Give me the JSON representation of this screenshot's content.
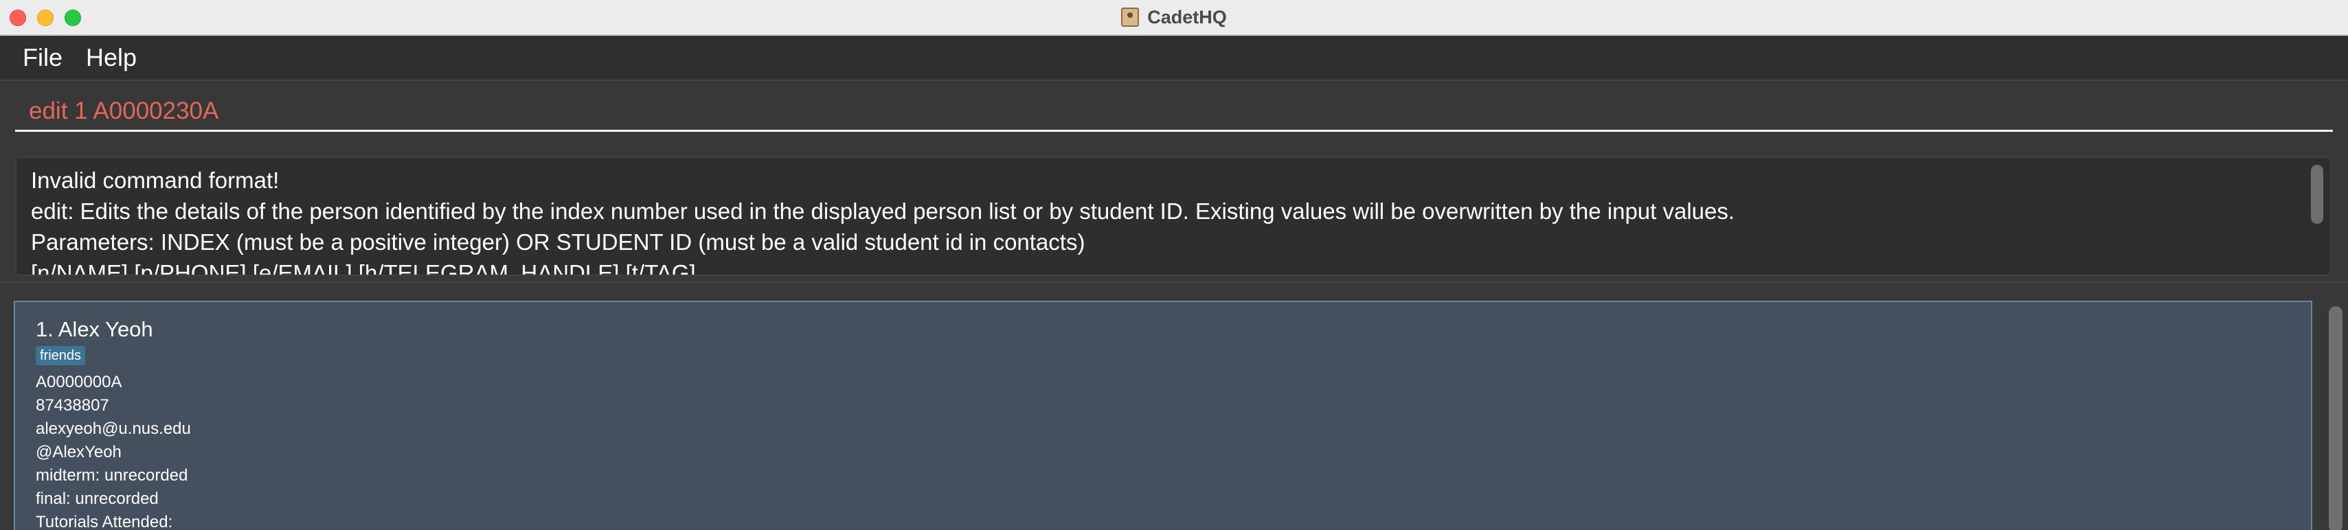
{
  "window": {
    "title": "CadetHQ"
  },
  "menu": {
    "items": [
      {
        "label": "File"
      },
      {
        "label": "Help"
      }
    ]
  },
  "command": {
    "value": "edit 1 A0000230A"
  },
  "result": {
    "lines": [
      "Invalid command format!",
      "edit: Edits the details of the person identified by the index number used in the displayed person list or by student ID. Existing values will be overwritten by the input values.",
      "Parameters: INDEX (must be a positive integer) OR STUDENT ID (must be a valid student id in contacts)",
      "[n/NAME] [p/PHONE] [e/EMAIL] [h/TELEGRAM_HANDLE] [t/TAG]"
    ]
  },
  "persons": [
    {
      "index_name": "1. Alex Yeoh",
      "tags": [
        "friends"
      ],
      "student_id": "A0000000A",
      "phone": "87438807",
      "email": "alexyeoh@u.nus.edu",
      "telegram": "@AlexYeoh",
      "midterm": "midterm: unrecorded",
      "final": "final: unrecorded",
      "tutorials": "Tutorials Attended:"
    }
  ],
  "colors": {
    "command_text": "#e2685a",
    "card_bg": "#45505f",
    "tag_bg": "#3b7494",
    "window_bg": "#383838"
  }
}
